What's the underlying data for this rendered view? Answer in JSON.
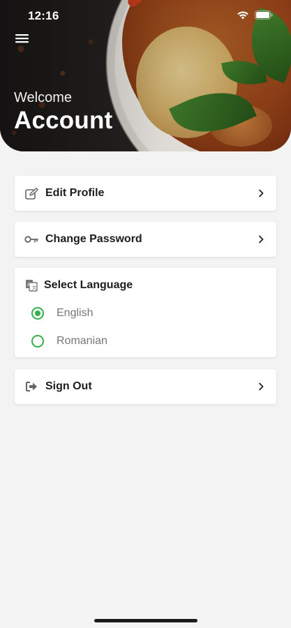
{
  "status_bar": {
    "time": "12:16",
    "icons": [
      "wifi-icon",
      "battery-icon"
    ]
  },
  "header": {
    "menu_icon": "hamburger-menu-icon",
    "welcome": "Welcome",
    "title": "Account"
  },
  "menu": {
    "edit_profile": {
      "label": "Edit Profile",
      "icon": "edit-icon"
    },
    "change_password": {
      "label": "Change Password",
      "icon": "key-icon"
    },
    "sign_out": {
      "label": "Sign Out",
      "icon": "sign-out-icon"
    }
  },
  "language": {
    "heading": "Select Language",
    "icon": "translate-icon",
    "options": [
      {
        "label": "English",
        "selected": true
      },
      {
        "label": "Romanian",
        "selected": false
      }
    ]
  },
  "colors": {
    "accent": "#33b24a",
    "background": "#f3f3f3",
    "card": "#ffffff"
  }
}
